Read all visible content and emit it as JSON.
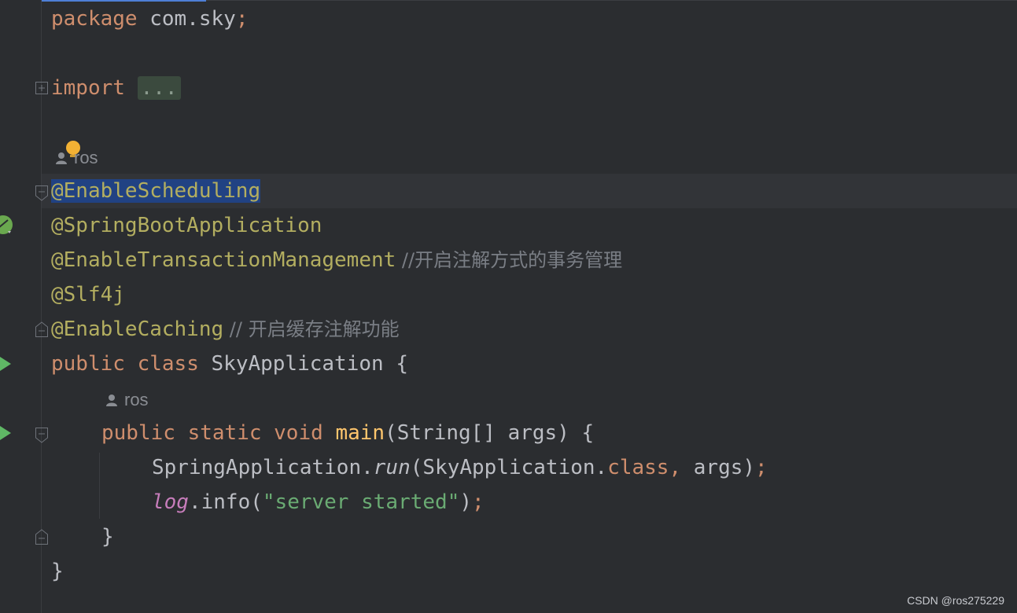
{
  "editor": {
    "lines": {
      "package_kw": "package",
      "package_name": " com.sky",
      "package_semi": ";",
      "import_kw": "import",
      "import_fold": "...",
      "ann_enable_scheduling": "@EnableScheduling",
      "ann_spring_boot": "@SpringBootApplication",
      "ann_enable_tx": "@EnableTransactionManagement",
      "comment_tx": " //开启注解方式的事务管理",
      "ann_slf4j": "@Slf4j",
      "ann_enable_caching": "@EnableCaching",
      "comment_caching": " // 开启缓存注解功能",
      "class_public": "public",
      "class_kw": "class",
      "class_name": " SkyApplication {",
      "main_public": "public",
      "main_static": "static",
      "main_void": "void",
      "main_name": "main",
      "main_params": "(String[] args) {",
      "run_obj": "SpringApplication.",
      "run_method": "run",
      "run_args_a": "(SkyApplication.",
      "run_class_kw": "class",
      "run_comma": ",",
      "run_args_b": " args)",
      "run_semi": ";",
      "log_field": "log",
      "log_call": ".info(",
      "log_string": "\"server started\"",
      "log_close": ")",
      "log_semi": ";",
      "close_method": "}",
      "close_class": "}"
    },
    "author_hints": [
      "ros",
      "ros"
    ]
  },
  "watermark": "CSDN @ros275229"
}
